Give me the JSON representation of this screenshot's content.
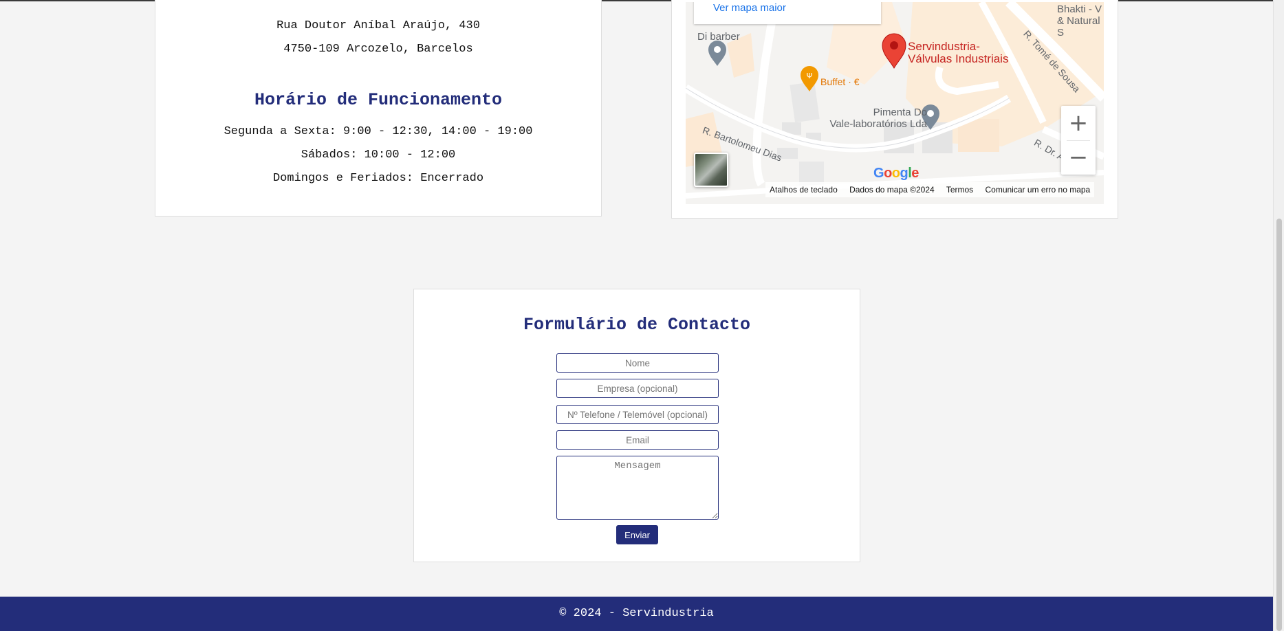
{
  "contact_info": {
    "address_line1": "Rua Doutor Aníbal Araújo, 430",
    "address_line2": "4750-109 Arcozelo, Barcelos",
    "hours_title": "Horário de Funcionamento",
    "hours": [
      "Segunda a Sexta: 9:00 - 12:30, 14:00 - 19:00",
      "Sábados: 10:00 - 12:00",
      "Domingos e Feriados: Encerrado"
    ]
  },
  "map": {
    "larger_map_link": "Ver mapa maior",
    "labels": {
      "di_barber": "Di barber",
      "servindustria_1": "Servindustria-",
      "servindustria_2": "Válvulas Industriais",
      "buffet": "Buffet · €",
      "pimenta_1": "Pimenta Do",
      "pimenta_2": "Vale-laboratórios Lda",
      "bhakti_1": "Bhakti - V",
      "bhakti_2": "& Natural S",
      "street_bartolomeu": "R. Bartolomeu Dias",
      "street_tome": "R. Tomé de Sousa",
      "street_dr": "R. Dr. A"
    },
    "zoom_in": "+",
    "zoom_out": "−",
    "google": "Google",
    "attribution": [
      "Atalhos de teclado",
      "Dados do mapa ©2024",
      "Termos",
      "Comunicar um erro no mapa"
    ],
    "colors": {
      "pin": "#ea4335",
      "brand_blue": "#4285f4"
    }
  },
  "contact_form": {
    "title": "Formulário de Contacto",
    "name_placeholder": "Nome",
    "company_placeholder": "Empresa (opcional)",
    "phone_placeholder": "Nº Telefone / Telemóvel (opcional)",
    "email_placeholder": "Email",
    "message_placeholder": "Mensagem",
    "submit_label": "Enviar"
  },
  "footer": {
    "text": "© 2024 - Servindustria"
  },
  "theme": {
    "primary": "#232d7a",
    "background": "#f4f4f4"
  }
}
